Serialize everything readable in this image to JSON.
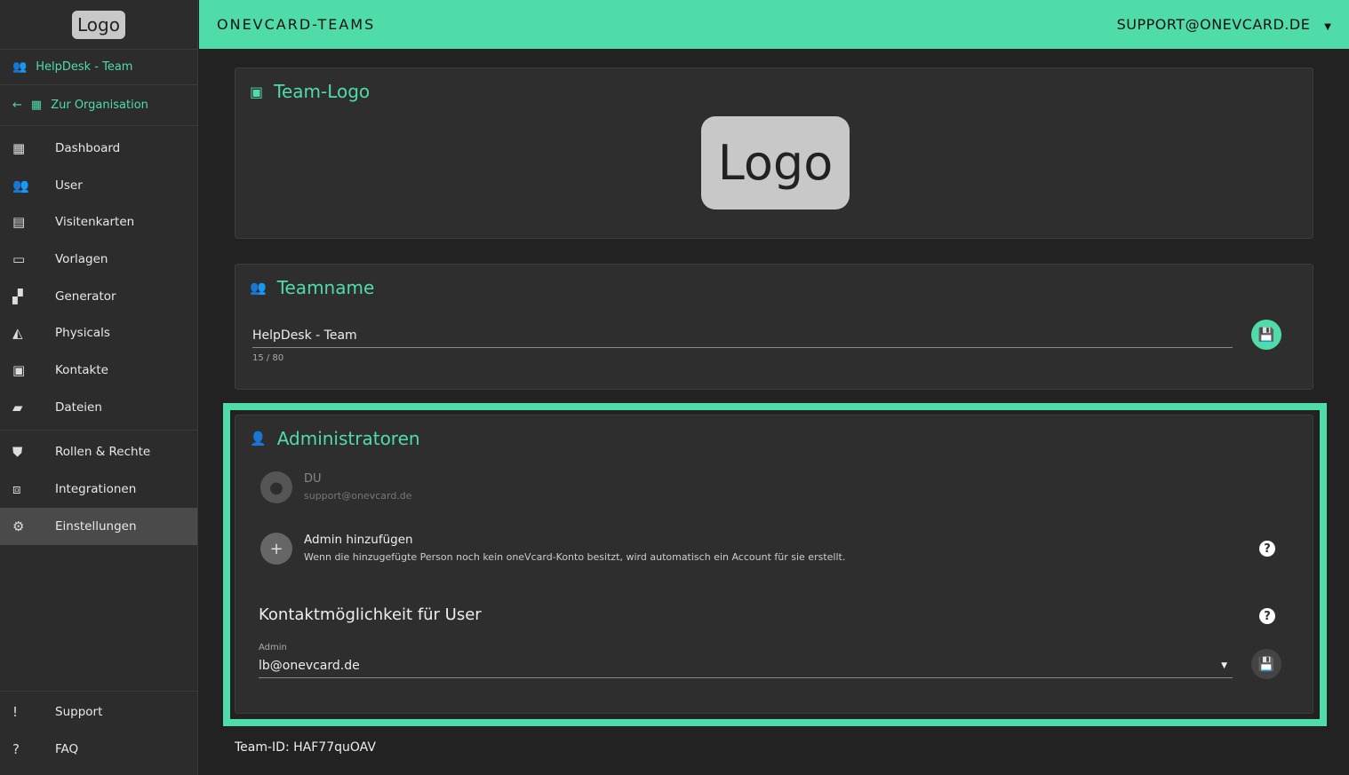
{
  "sidebar": {
    "logo": "Logo",
    "team": "HelpDesk - Team",
    "org": "Zur Organisation",
    "items": [
      {
        "label": "Dashboard",
        "icon": "▦"
      },
      {
        "label": "User",
        "icon": "👥"
      },
      {
        "label": "Visitenkarten",
        "icon": "▤"
      },
      {
        "label": "Vorlagen",
        "icon": "▭"
      },
      {
        "label": "Generator",
        "icon": "▞"
      },
      {
        "label": "Physicals",
        "icon": "◭"
      },
      {
        "label": "Kontakte",
        "icon": "▣"
      },
      {
        "label": "Dateien",
        "icon": "▰"
      },
      {
        "label": "Rollen & Rechte",
        "icon": "⛊"
      },
      {
        "label": "Integrationen",
        "icon": "⧈"
      },
      {
        "label": "Einstellungen",
        "icon": "⚙"
      }
    ],
    "bottom": [
      {
        "label": "Support",
        "icon": "!"
      },
      {
        "label": "FAQ",
        "icon": "?"
      }
    ]
  },
  "topbar": {
    "brand": "ONEVCARD-TEAMS",
    "account": "SUPPORT@ONEVCARD.DE"
  },
  "logo_card": {
    "title": "Team-Logo",
    "logo": "Logo"
  },
  "name_card": {
    "title": "Teamname",
    "value": "HelpDesk - Team",
    "counter": "15 / 80"
  },
  "admin_card": {
    "title": "Administratoren",
    "admin_name": "DU",
    "admin_email": "support@onevcard.de",
    "add_title": "Admin hinzufügen",
    "add_desc": "Wenn die hinzugefügte Person noch kein oneVcard-Konto besitzt, wird automatisch ein Account für sie erstellt.",
    "contact_title": "Kontaktmöglichkeit für User",
    "select_label": "Admin",
    "select_value": "lb@onevcard.de"
  },
  "footer": {
    "team_id": "Team-ID: HAF77quOAV"
  },
  "colors": {
    "accent": "#50dca9"
  }
}
